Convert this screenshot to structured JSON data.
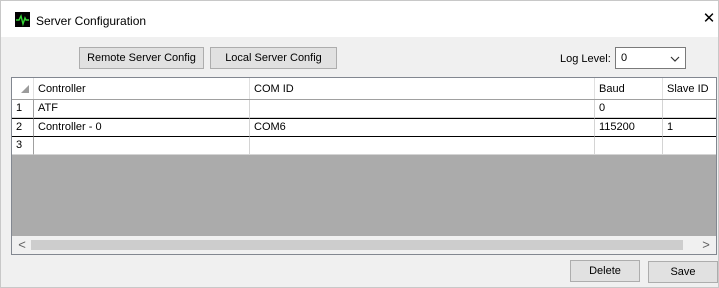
{
  "window": {
    "title": "Server Configuration",
    "app_icon": "pulse-icon",
    "close_glyph": "✕"
  },
  "toolbar": {
    "remote_label": "Remote Server Config",
    "local_label": "Local Server Config",
    "log_level_label": "Log Level:",
    "log_level_value": "0"
  },
  "grid": {
    "columns": [
      "Controller",
      "COM ID",
      "Baud",
      "Slave ID"
    ],
    "rows": [
      {
        "num": "1",
        "controller": "ATF",
        "com_id": "",
        "baud": "0",
        "slave_id": ""
      },
      {
        "num": "2",
        "controller": "Controller - 0",
        "com_id": "COM6",
        "baud": "115200",
        "slave_id": "1"
      },
      {
        "num": "3",
        "controller": "",
        "com_id": "",
        "baud": "",
        "slave_id": ""
      }
    ]
  },
  "scrollbar": {
    "left_glyph": "<",
    "right_glyph": ">"
  },
  "footer": {
    "delete_label": "Delete",
    "save_label": "Save"
  },
  "colors": {
    "window_bg": "#f0f0f0",
    "grid_bg": "#ababab",
    "button_bg": "#e1e1e1"
  }
}
